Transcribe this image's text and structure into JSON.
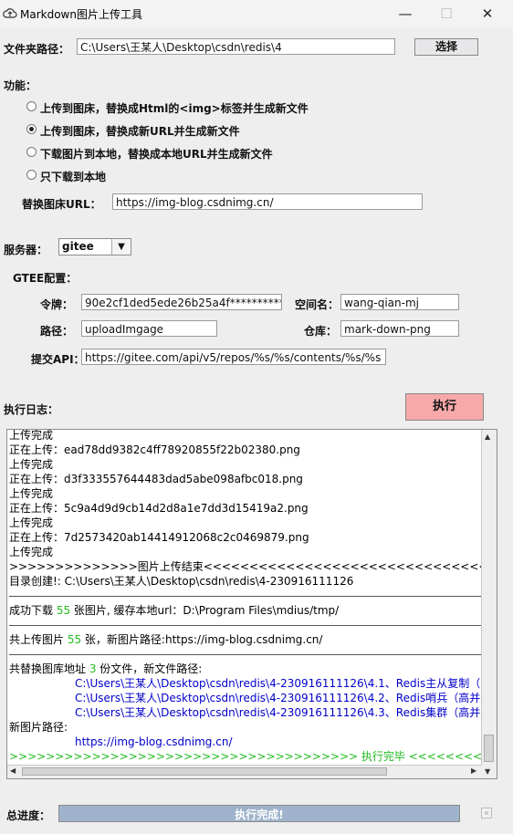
{
  "window": {
    "title": "Markdown图片上传工具",
    "minimize": "—",
    "maximize": "☐",
    "close": "✕"
  },
  "folder": {
    "label": "文件夹路径：",
    "value": "C:\\Users\\王某人\\Desktop\\csdn\\redis\\4",
    "choose_button": "选择"
  },
  "function": {
    "label": "功能：",
    "options": [
      {
        "label": "上传到图床，替换成Html的<img>标签并生成新文件",
        "selected": false
      },
      {
        "label": "上传到图床，替换成新URL并生成新文件",
        "selected": true
      },
      {
        "label": "下载图片到本地，替换成本地URL并生成新文件",
        "selected": false
      },
      {
        "label": "只下载到本地",
        "selected": false
      }
    ],
    "replace_url_label": "替换图床URL：",
    "replace_url_value": "https://img-blog.csdnimg.cn/"
  },
  "server": {
    "label": "服务器：",
    "selected": "gitee"
  },
  "gitee": {
    "section_label": "GTEE配置：",
    "token_label": "令牌：",
    "token_value": "90e2cf1ded5ede26b25a4f*************",
    "namespace_label": "空间名：",
    "namespace_value": "wang-qian-mj",
    "path_label": "路径：",
    "path_value": "uploadImgage",
    "repo_label": "仓库：",
    "repo_value": "mark-down-png",
    "api_label": "提交API：",
    "api_value": "https://gitee.com/api/v5/repos/%s/%s/contents/%s/%s"
  },
  "log": {
    "label": "执行日志：",
    "execute_button": "执行",
    "lines": {
      "l1": "上传完成",
      "l2": "正在上传：ead78dd9382c4ff78920855f22b02380.png",
      "l3": "上传完成",
      "l4": "正在上传：d3f333557644483dad5abe098afbc018.png",
      "l5": "上传完成",
      "l6": "正在上传：5c9a4d9d9cb14d2d8a1e7dd3d15419a2.png",
      "l7": "上传完成",
      "l8": "正在上传：7d2573420ab14414912068c2c0469879.png",
      "l9": "上传完成",
      "l10": ">>>>>>>>>>>>>>图片上传结束<<<<<<<<<<<<<<<<<<<<<<<<<<<<<<<<<<<<<<<<<<<<<<<<<",
      "l11": "目录创建!: C:\\Users\\王某人\\Desktop\\csdn\\redis\\4-230916111126",
      "l13a": "成功下载 ",
      "l13n": "55",
      "l13b": " 张图片, 缓存本地url：D:\\Program Files\\mdius/tmp/",
      "l15a": "共上传图片 ",
      "l15n": "55",
      "l15b": " 张，新图片路径:https://img-blog.csdnimg.cn/",
      "l17a": "共替换图库地址 ",
      "l17n": "3",
      "l17b": " 份文件，新文件路径:",
      "f1": "C:\\Users\\王某人\\Desktop\\csdn\\redis\\4-230916111126\\4.1、Redis主从复制（高并发",
      "f2": "C:\\Users\\王某人\\Desktop\\csdn\\redis\\4-230916111126\\4.2、Redis哨兵（高并发高可用",
      "f3": "C:\\Users\\王某人\\Desktop\\csdn\\redis\\4-230916111126\\4.3、Redis集群（高并发高可用",
      "l21": "新图片路径:",
      "l22": "https://img-blog.csdnimg.cn/",
      "l23": ">>>>>>>>>>>>>>>>>>>>>>>>>>>>>>>>>>>>>> 执行完毕 <<<<<<<<<<<<<<<<<<<<<<<<<<<<<<<<<<<<<<"
    }
  },
  "progress": {
    "label": "总进度：",
    "text": "执行完成!",
    "percent": 100
  },
  "colors": {
    "execute_button": "#f7a9a9",
    "progress_fill": "#9fb3cc",
    "link": "#0000cc",
    "highlight": "#22bb22"
  }
}
